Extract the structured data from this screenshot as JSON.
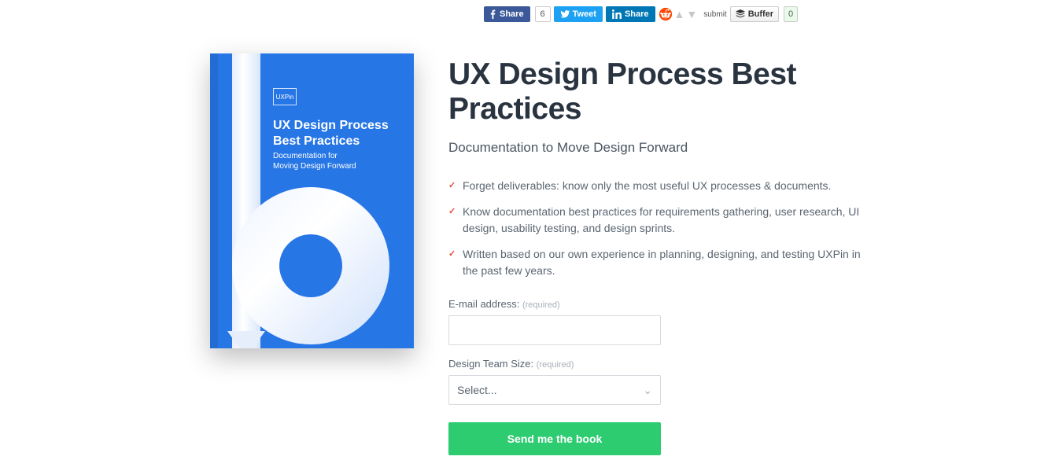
{
  "share": {
    "facebook_label": "Share",
    "facebook_count": "6",
    "twitter_label": "Tweet",
    "linkedin_label": "Share",
    "reddit_submit": "submit",
    "buffer_label": "Buffer",
    "buffer_count": "0"
  },
  "book": {
    "logo": "UXPin",
    "title_line1": "UX Design Process",
    "title_line2": "Best Practices",
    "subtitle_line1": "Documentation for",
    "subtitle_line2": "Moving Design Forward"
  },
  "page": {
    "title": "UX Design Process Best Practices",
    "subtitle": "Documentation to Move Design Forward"
  },
  "bullets": [
    "Forget deliverables: know only the most useful UX processes & documents.",
    "Know documentation best practices for requirements gathering, user research, UI design, usability testing, and design sprints.",
    "Written based on our own experience in planning, designing, and testing UXPin in the past few years."
  ],
  "form": {
    "email_label": "E-mail address:",
    "required": "(required)",
    "team_label": "Design Team Size:",
    "select_placeholder": "Select...",
    "submit_label": "Send me the book"
  }
}
